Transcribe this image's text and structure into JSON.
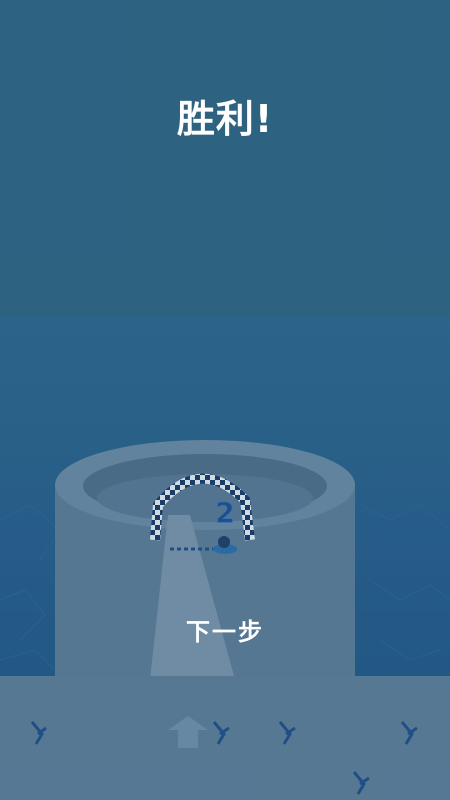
{
  "title": "胜利!",
  "next_button_label": "下一步",
  "level_marker": "2",
  "colors": {
    "sky": "#2e6585",
    "sea": "#235f93",
    "tower": "#5c7d98",
    "checker_dark": "#173b66",
    "text": "#ffffff"
  }
}
